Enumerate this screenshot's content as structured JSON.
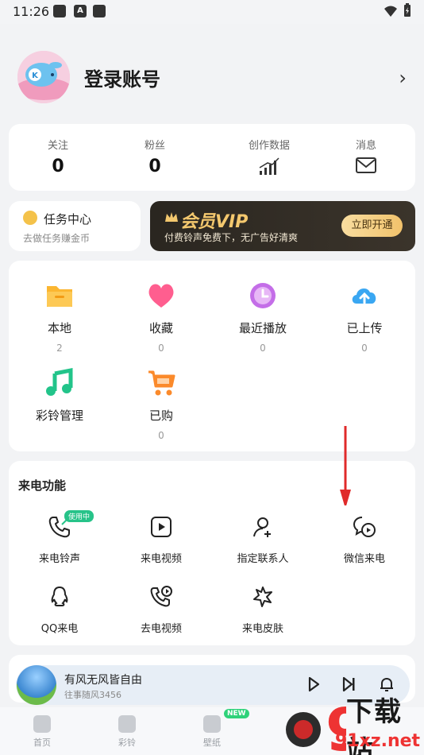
{
  "status_bar": {
    "time": "11:26",
    "icons": [
      "square-icon",
      "a-icon",
      "square-icon"
    ],
    "right_icons": [
      "wifi-icon",
      "battery-icon"
    ]
  },
  "profile": {
    "login_label": "登录账号"
  },
  "stats": [
    {
      "label": "关注",
      "value": "0"
    },
    {
      "label": "粉丝",
      "value": "0"
    },
    {
      "label": "创作数据",
      "icon": "bar-chart-icon"
    },
    {
      "label": "消息",
      "icon": "mail-icon"
    }
  ],
  "task_center": {
    "title": "任务中心",
    "subtitle": "去做任务赚金币"
  },
  "vip": {
    "title": "会员VIP",
    "subtitle": "付费铃声免费下，无广告好清爽",
    "button": "立即开通"
  },
  "library": [
    {
      "label": "本地",
      "count": "2",
      "icon": "folder-icon"
    },
    {
      "label": "收藏",
      "count": "0",
      "icon": "heart-icon"
    },
    {
      "label": "最近播放",
      "count": "0",
      "icon": "clock-icon"
    },
    {
      "label": "已上传",
      "count": "0",
      "icon": "cloud-upload-icon"
    },
    {
      "label": "彩铃管理",
      "icon": "music-note-icon"
    },
    {
      "label": "已购",
      "count": "0",
      "icon": "cart-icon"
    }
  ],
  "call_section": {
    "title": "来电功能",
    "items": [
      {
        "label": "来电铃声",
        "badge": "使用中",
        "icon": "phone-ring-icon"
      },
      {
        "label": "来电视频",
        "icon": "video-play-icon"
      },
      {
        "label": "指定联系人",
        "icon": "add-contact-icon"
      },
      {
        "label": "微信来电",
        "icon": "wechat-call-icon"
      },
      {
        "label": "QQ来电",
        "icon": "qq-icon"
      },
      {
        "label": "去电视频",
        "icon": "outgoing-video-icon"
      },
      {
        "label": "来电皮肤",
        "icon": "skin-icon"
      }
    ]
  },
  "player": {
    "title": "有风无风皆自由",
    "subtitle": "往事随风3456"
  },
  "tabs": [
    {
      "label": "首页",
      "icon": "home-icon"
    },
    {
      "label": "彩铃",
      "icon": "ringtone-icon"
    },
    {
      "label": "壁纸",
      "icon": "wallpaper-icon",
      "badge": "NEW"
    }
  ],
  "watermark": {
    "top": "下载站",
    "bottom": "91xz.net",
    "logo": "9"
  },
  "colors": {
    "accent_green": "#27c389",
    "vip_gold": "#f4c86e",
    "arrow_red": "#e02a2a"
  }
}
